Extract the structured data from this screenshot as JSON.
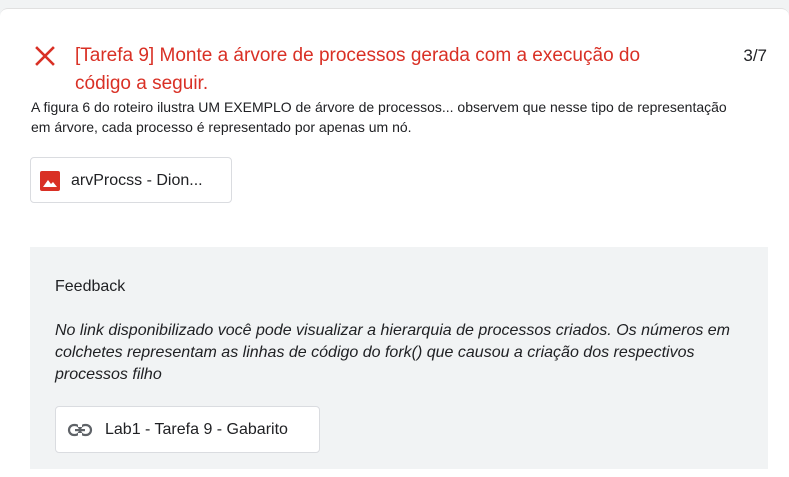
{
  "question": {
    "status_icon": "close-icon",
    "status_color": "#d93025",
    "title": "[Tarefa 9] Monte a árvore de processos gerada com a execução do código a seguir.",
    "points": "3/7",
    "description": "A figura 6 do roteiro ilustra UM EXEMPLO de árvore de processos... observem que nesse tipo de representação em árvore, cada processo é representado por apenas um nó.",
    "attachment": {
      "icon": "image-icon",
      "icon_color": "#d93025",
      "label": "arvProcss - Dion..."
    }
  },
  "feedback": {
    "heading": "Feedback",
    "text": "No link disponibilizado você pode visualizar a hierarquia de processos criados. Os números em colchetes representam as linhas de código do fork() que causou a criação dos respectivos processos filho",
    "link": {
      "icon": "link-icon",
      "label": "Lab1 - Tarefa 9 - Gabarito"
    }
  }
}
